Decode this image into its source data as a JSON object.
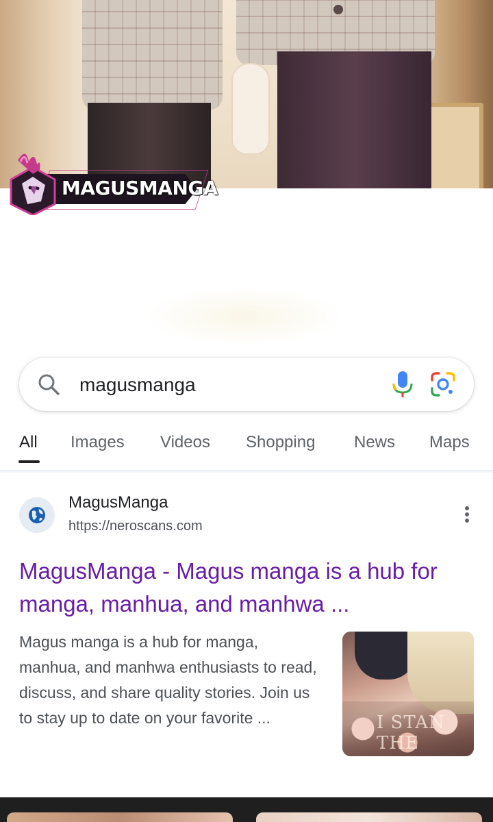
{
  "watermark": {
    "logo_text": "MAGUSMANGA"
  },
  "search": {
    "query": "magusmanga"
  },
  "tabs": [
    {
      "label": "All",
      "active": true
    },
    {
      "label": "Images",
      "active": false
    },
    {
      "label": "Videos",
      "active": false
    },
    {
      "label": "Shopping",
      "active": false
    },
    {
      "label": "News",
      "active": false
    },
    {
      "label": "Maps",
      "active": false
    }
  ],
  "result": {
    "site_name": "MagusManga",
    "url": "https://neroscans.com",
    "title": "MagusManga - Magus manga is a hub for manga, manhua, and manhwa ...",
    "snippet": "Magus manga is a hub for manga, manhua, and manhwa enthusiasts to read, discuss, and share quality stories. Join us to stay up to date on your favorite ...",
    "thumbnail_text": "I STAN THE"
  },
  "colors": {
    "title_link": "#681da8",
    "text_primary": "#202124",
    "text_secondary": "#4d5156",
    "logo_accent": "#c43a8c"
  }
}
